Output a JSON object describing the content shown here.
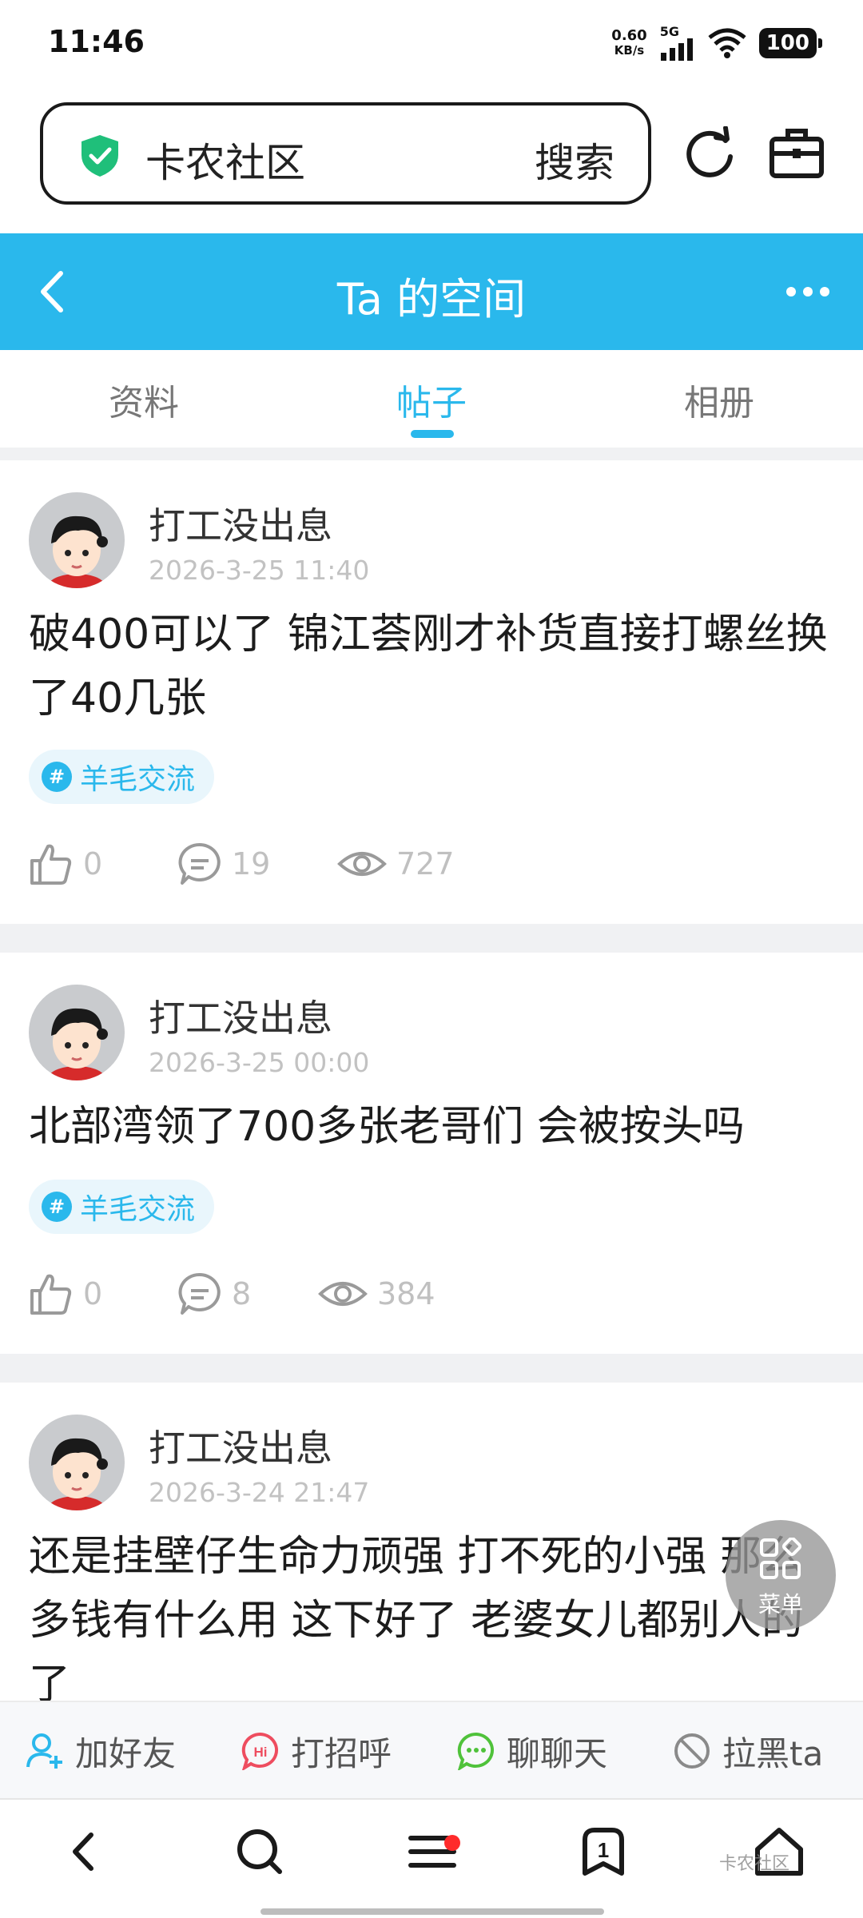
{
  "status_bar": {
    "time": "11:46",
    "net_speed_value": "0.60",
    "net_speed_unit": "KB/s",
    "network": "5G",
    "battery": "100"
  },
  "browser": {
    "site_name": "卡农社区",
    "search_label": "搜索",
    "shield_color": "#1fbf7a"
  },
  "header": {
    "title": "Ta 的空间",
    "background": "#2ab8ec"
  },
  "tabs": [
    {
      "label": "资料",
      "active": false
    },
    {
      "label": "帖子",
      "active": true
    },
    {
      "label": "相册",
      "active": false
    }
  ],
  "posts": [
    {
      "author": "打工没出息",
      "time": "2026-3-25 11:40",
      "body": "破400可以了 锦江荟刚才补货直接打螺丝换了40几张",
      "tag": "羊毛交流",
      "likes": "0",
      "comments": "19",
      "views": "727"
    },
    {
      "author": "打工没出息",
      "time": "2026-3-25 00:00",
      "body": "北部湾领了700多张老哥们 会被按头吗",
      "tag": "羊毛交流",
      "likes": "0",
      "comments": "8",
      "views": "384"
    },
    {
      "author": "打工没出息",
      "time": "2026-3-24 21:47",
      "body": "还是挂壁仔生命力顽强 打不死的小强 那么多钱有什么用 这下好了 老婆女儿都别人的了"
    }
  ],
  "float_menu": {
    "label": "菜单"
  },
  "actions": [
    {
      "label": "加好友",
      "icon": "add-user-icon"
    },
    {
      "label": "打招呼",
      "icon": "hi-icon"
    },
    {
      "label": "聊聊天",
      "icon": "chat-icon"
    },
    {
      "label": "拉黑ta",
      "icon": "block-icon"
    }
  ],
  "nav": {
    "watermark": "卡农社区"
  }
}
